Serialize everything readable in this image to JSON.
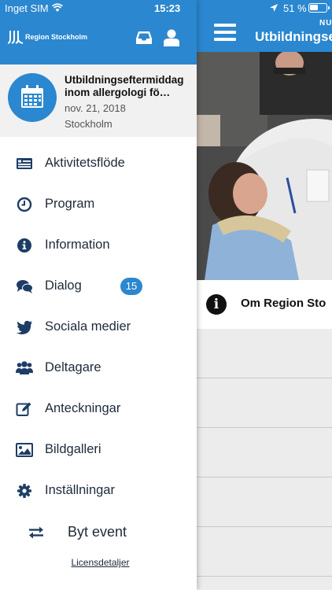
{
  "status_bar": {
    "carrier": "Inget SIM",
    "time": "15:23",
    "battery_percent": "51 %"
  },
  "header": {
    "logo_text": "Region Stockholm"
  },
  "event": {
    "title": "Utbildningseftermiddag inom allergologi fö…",
    "date": "nov. 21, 2018",
    "location": "Stockholm"
  },
  "menu": {
    "items": [
      {
        "label": "Aktivitetsflöde",
        "icon": "news-feed-icon"
      },
      {
        "label": "Program",
        "icon": "clock-icon"
      },
      {
        "label": "Information",
        "icon": "info-icon"
      },
      {
        "label": "Dialog",
        "icon": "chat-icon",
        "badge": "15"
      },
      {
        "label": "Sociala medier",
        "icon": "twitter-icon"
      },
      {
        "label": "Deltagare",
        "icon": "users-icon"
      },
      {
        "label": "Anteckningar",
        "icon": "edit-icon"
      },
      {
        "label": "Bildgalleri",
        "icon": "image-icon"
      },
      {
        "label": "Inställningar",
        "icon": "gear-icon"
      }
    ]
  },
  "switch_event": {
    "label": "Byt event"
  },
  "license": {
    "label": "Licensdetaljer"
  },
  "background": {
    "small_label": "NU",
    "title": "Utbildningse",
    "info_row": "Om Region Sto"
  },
  "colors": {
    "brand_blue": "#2b87cf",
    "text_dark": "#1e2a3a"
  }
}
